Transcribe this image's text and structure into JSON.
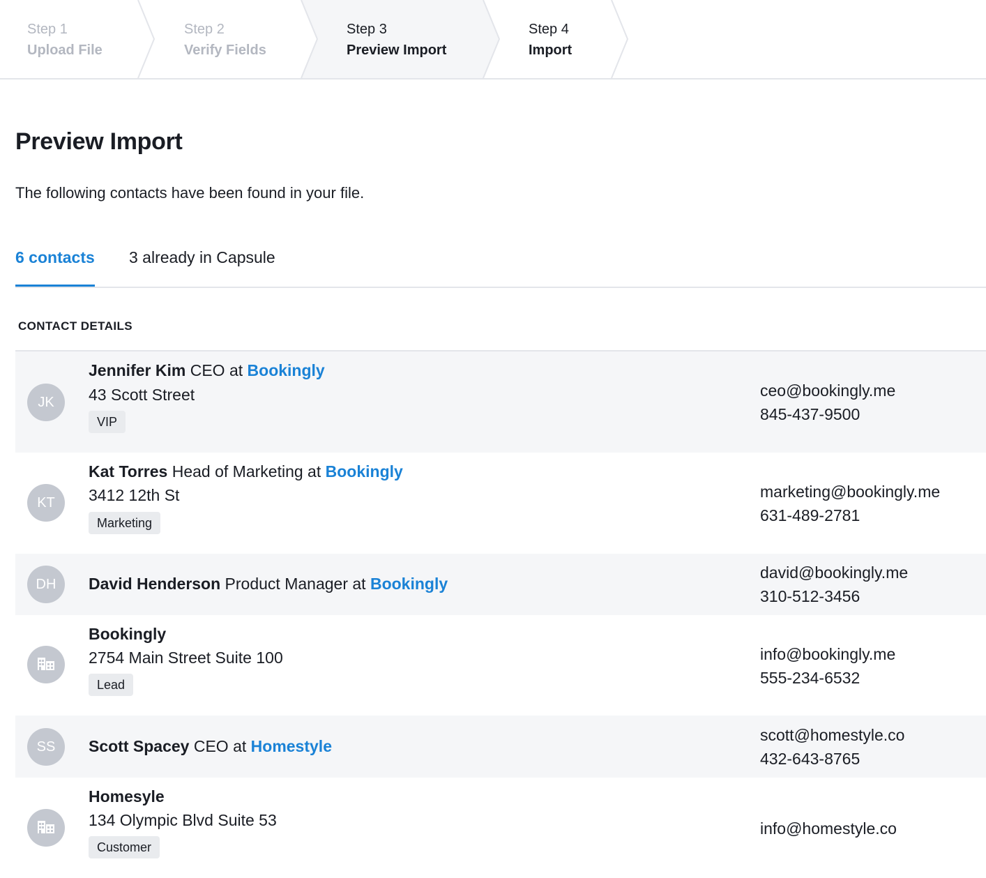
{
  "stepper": {
    "steps": [
      {
        "num": "Step 1",
        "name": "Upload File",
        "state": "done"
      },
      {
        "num": "Step 2",
        "name": "Verify Fields",
        "state": "done"
      },
      {
        "num": "Step 3",
        "name": "Preview Import",
        "state": "current"
      },
      {
        "num": "Step 4",
        "name": "Import",
        "state": "next"
      }
    ]
  },
  "page": {
    "title": "Preview Import",
    "intro": "The following contacts have been found in your file."
  },
  "tabs": [
    {
      "label": "6 contacts",
      "active": true
    },
    {
      "label": "3 already in Capsule",
      "active": false
    }
  ],
  "section": {
    "heading": "CONTACT DETAILS"
  },
  "contacts": [
    {
      "initials": "JK",
      "icon": "person-initials",
      "name": "Jennifer Kim",
      "role": "CEO at",
      "org": "Bookingly",
      "address": "43 Scott Street",
      "tag": "VIP",
      "email": "ceo@bookingly.me",
      "phone": "845-437-9500"
    },
    {
      "initials": "KT",
      "icon": "person-initials",
      "name": "Kat Torres",
      "role": "Head of Marketing at",
      "org": "Bookingly",
      "address": "3412 12th St",
      "tag": "Marketing",
      "email": "marketing@bookingly.me",
      "phone": "631-489-2781"
    },
    {
      "initials": "DH",
      "icon": "person-initials",
      "name": "David Henderson",
      "role": "Product Manager at",
      "org": "Bookingly",
      "email": "david@bookingly.me",
      "phone": "310-512-3456"
    },
    {
      "icon": "building-icon",
      "name": "Bookingly",
      "address": "2754 Main Street Suite 100",
      "tag": "Lead",
      "email": "info@bookingly.me",
      "phone": "555-234-6532"
    },
    {
      "initials": "SS",
      "icon": "person-initials",
      "name": "Scott Spacey",
      "role": "CEO at",
      "org": "Homestyle",
      "email": "scott@homestyle.co",
      "phone": "432-643-8765"
    },
    {
      "icon": "building-icon",
      "name": "Homesyle",
      "address": "134 Olympic Blvd Suite 53",
      "tag": "Customer",
      "email": "info@homestyle.co"
    }
  ],
  "colors": {
    "accent": "#1a82d6",
    "muted": "#b3b7c0",
    "avatar": "#c4c8d0",
    "row_shade": "#f5f6f8"
  }
}
